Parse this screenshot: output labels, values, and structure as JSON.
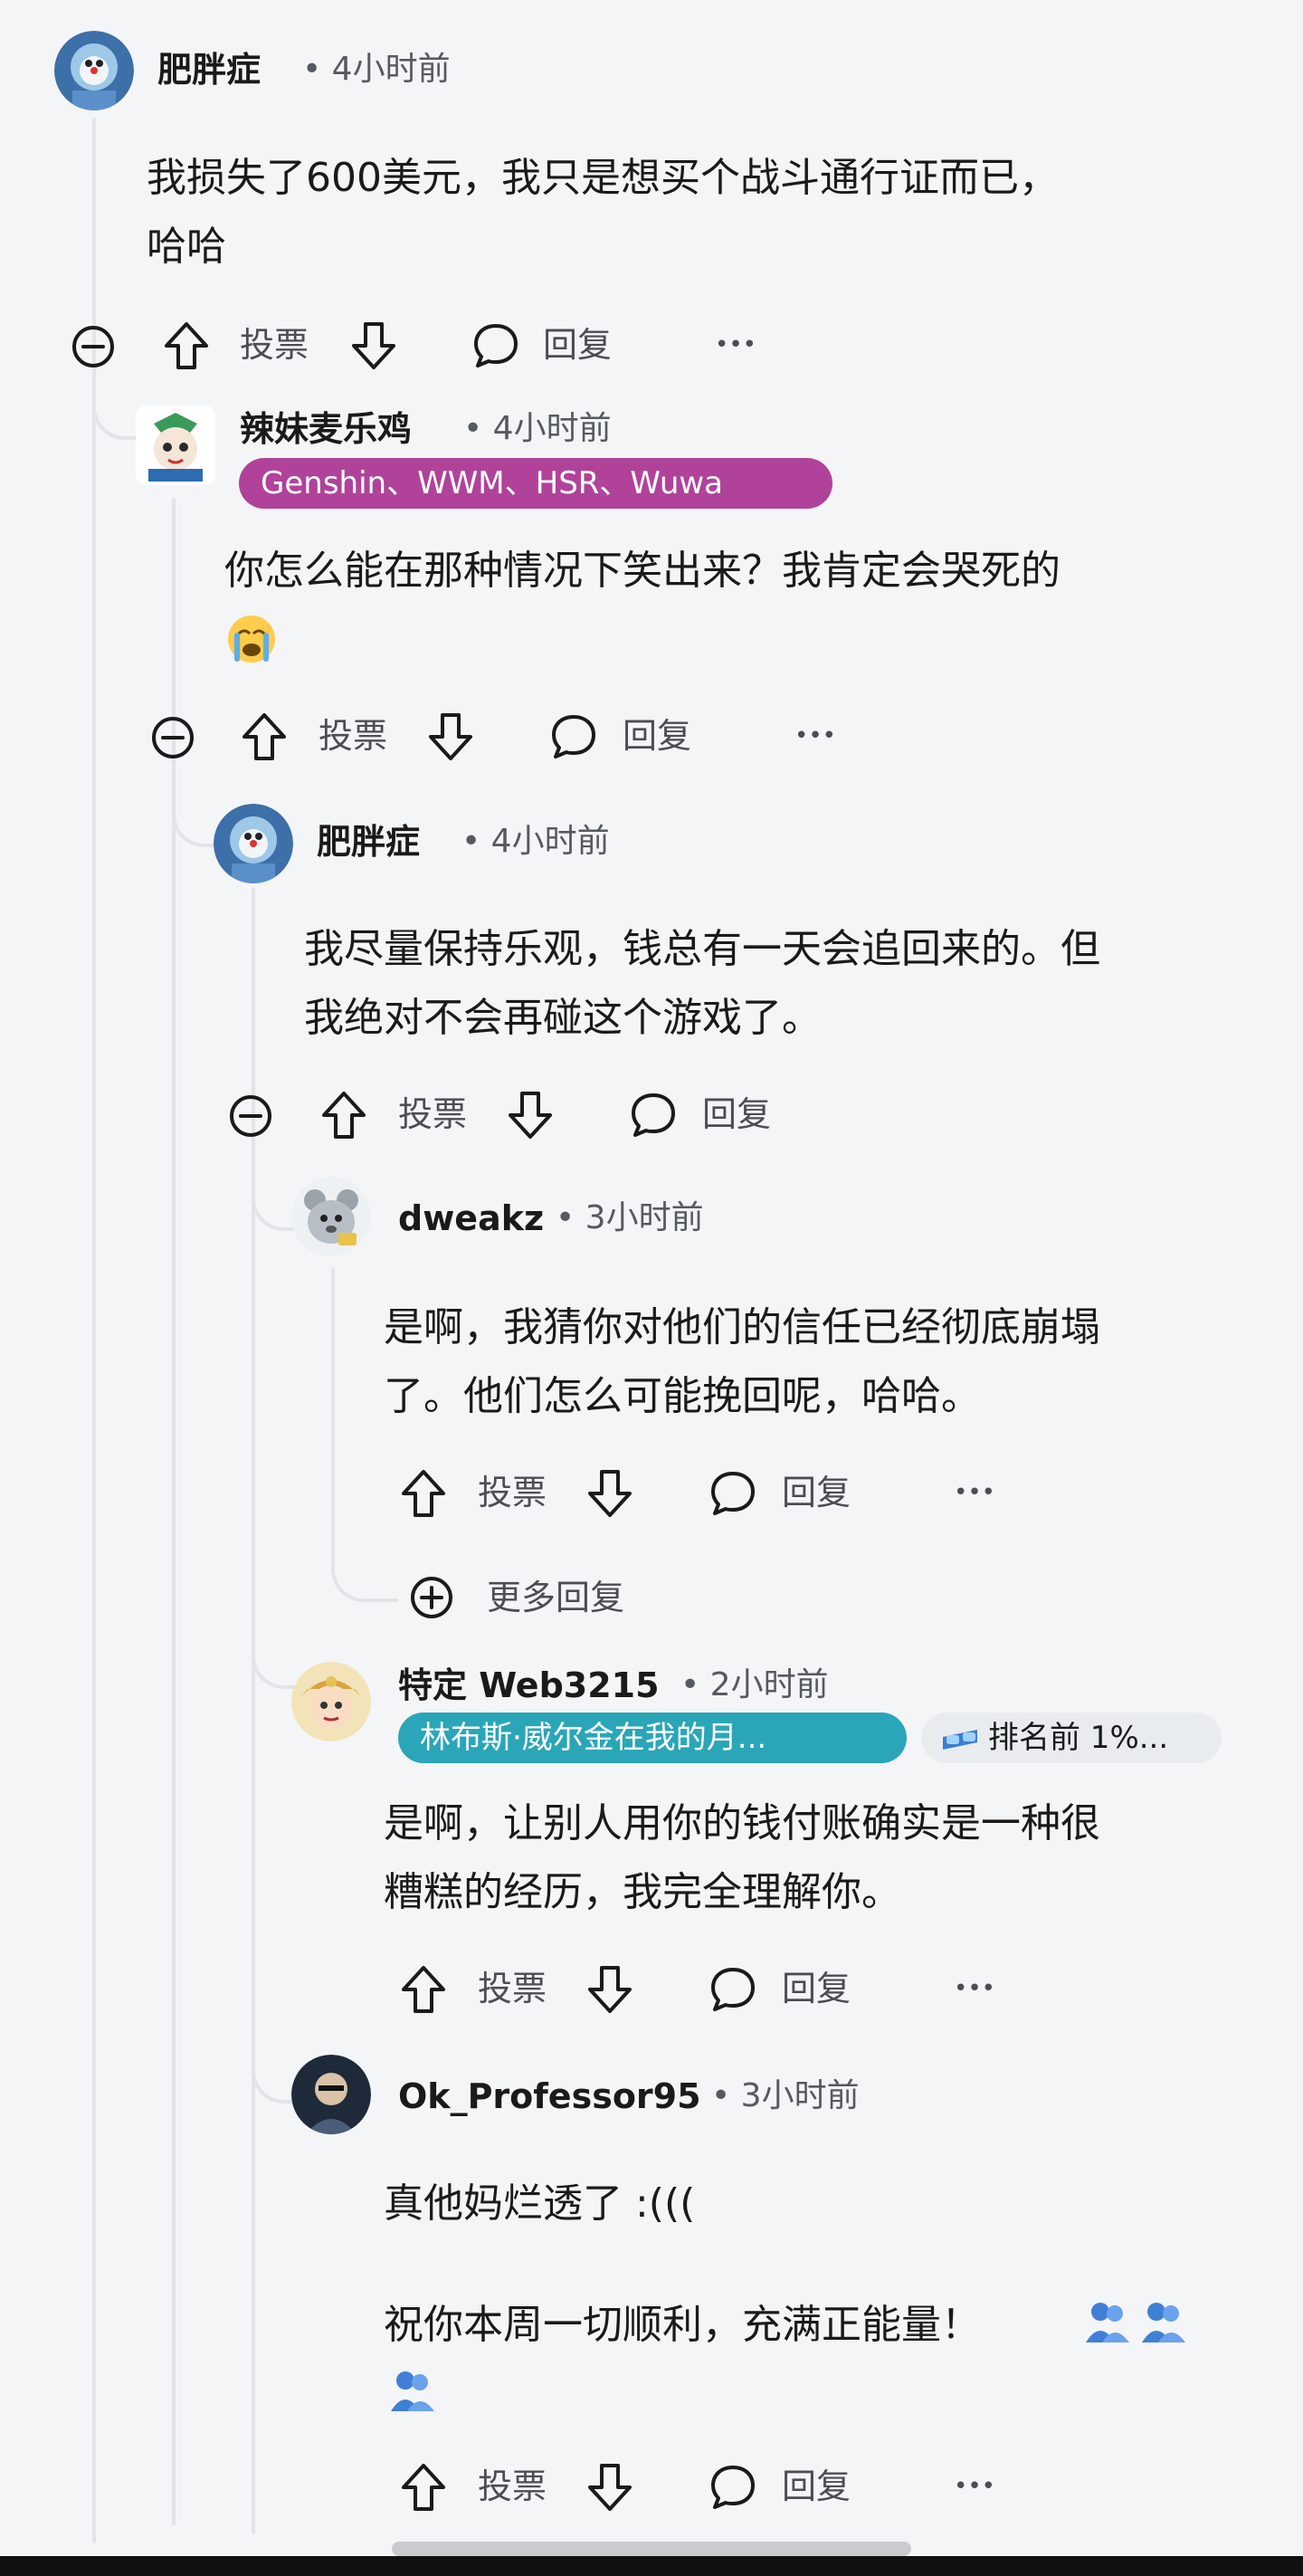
{
  "comments": [
    {
      "username": "肥胖症",
      "time": "• 4小时前",
      "lines": [
        "我损失了600美元，我只是想买个战斗通行证而已，",
        "哈哈"
      ]
    },
    {
      "username": "辣妹麦乐鸡",
      "time": "• 4小时前",
      "flair": "Genshin、WWM、HSR、Wuwa",
      "lines": [
        "你怎么能在那种情况下笑出来？我肯定会哭死的"
      ]
    },
    {
      "username": "肥胖症",
      "time": "• 4小时前",
      "lines": [
        "我尽量保持乐观，钱总有一天会追回来的。但",
        "我绝对不会再碰这个游戏了。"
      ]
    },
    {
      "username": "dweakz",
      "time": "• 3小时前",
      "lines": [
        "是啊，我猜你对他们的信任已经彻底崩塌",
        "了。他们怎么可能挽回呢，哈哈。"
      ]
    },
    {
      "username": "特定 Web3215",
      "time": "• 2小时前",
      "flair": "林布斯·威尔金在我的月...",
      "badge": "排名前 1%...",
      "lines": [
        "是啊，让别人用你的钱付账确实是一种很",
        "糟糕的经历，我完全理解你。"
      ]
    },
    {
      "username": "Ok_Professor95",
      "time": "• 3小时前",
      "lines": [
        "真他妈烂透了 :(((",
        "祝你本周一切顺利，充满正能量！"
      ]
    }
  ],
  "actions": {
    "vote": "投票",
    "reply": "回复",
    "more": "•••"
  },
  "more_replies": "更多回复",
  "colors": {
    "flair_pink": "#b0429a",
    "flair_teal": "#2aa6b8",
    "badge_bg": "#e9ecef",
    "thread_line": "#e2e4e8"
  },
  "icons": [
    "collapse-icon",
    "upvote-icon",
    "downvote-icon",
    "comment-icon",
    "more-icon",
    "expand-icon",
    "crying-emoji",
    "people-emoji",
    "goggles-icon"
  ]
}
